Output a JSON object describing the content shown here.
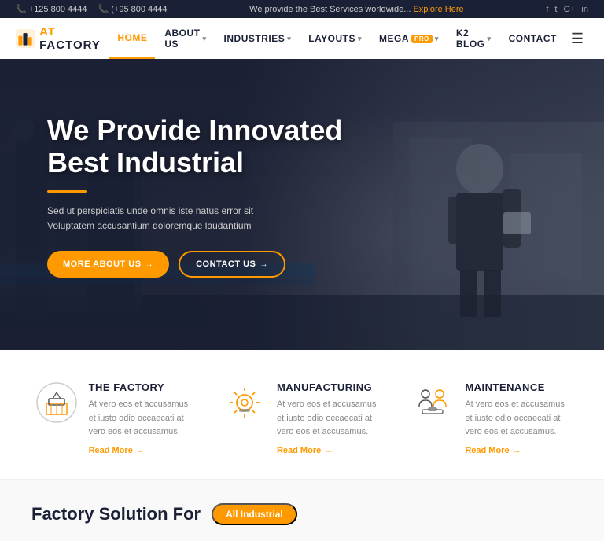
{
  "topbar": {
    "phone1": "+125 800 4444",
    "phone2": "(+95 800 4444",
    "tagline": "We provide the Best Services worldwide...",
    "explore_link": "Explore Here",
    "social_icons": [
      "facebook",
      "twitter",
      "google-plus",
      "linkedin"
    ]
  },
  "navbar": {
    "logo_name": "AT FACTORY",
    "logo_at": "AT",
    "logo_factory": "FACTORY",
    "nav_items": [
      {
        "label": "HOME",
        "active": true,
        "has_arrow": false
      },
      {
        "label": "ABOUT US",
        "active": false,
        "has_arrow": true
      },
      {
        "label": "INDUSTRIES",
        "active": false,
        "has_arrow": true
      },
      {
        "label": "LAYOUTS",
        "active": false,
        "has_arrow": true
      },
      {
        "label": "MEGA",
        "active": false,
        "has_arrow": true,
        "badge": "PRO"
      },
      {
        "label": "K2 BLOG",
        "active": false,
        "has_arrow": true
      },
      {
        "label": "CONTACT",
        "active": false,
        "has_arrow": false
      }
    ]
  },
  "hero": {
    "title_line1": "We Provide Innovated",
    "title_line2": "Best Industrial",
    "subtitle": "Sed ut perspiciatis unde omnis iste natus error sit Voluptatem accusantium doloremque laudantium",
    "btn_more": "More About Us",
    "btn_contact": "Contact Us"
  },
  "services": [
    {
      "id": "factory",
      "title": "THE FACTORY",
      "description": "At vero eos et accusamus et iusto odio occaecati at vero eos et accusamus.",
      "link": "Read More"
    },
    {
      "id": "manufacturing",
      "title": "MANUFACTURING",
      "description": "At vero eos et accusamus et iusto odio occaecati at vero eos et accusamus.",
      "link": "Read More"
    },
    {
      "id": "maintenance",
      "title": "MAINTENANCE",
      "description": "At vero eos et accusamus et iusto odio occaecati at vero eos et accusamus.",
      "link": "Read More"
    }
  ],
  "factory_solution": {
    "title": "Factory Solution For",
    "badge": "All Industrial"
  },
  "colors": {
    "accent": "#f90",
    "dark": "#1a2035",
    "text_light": "#888"
  }
}
